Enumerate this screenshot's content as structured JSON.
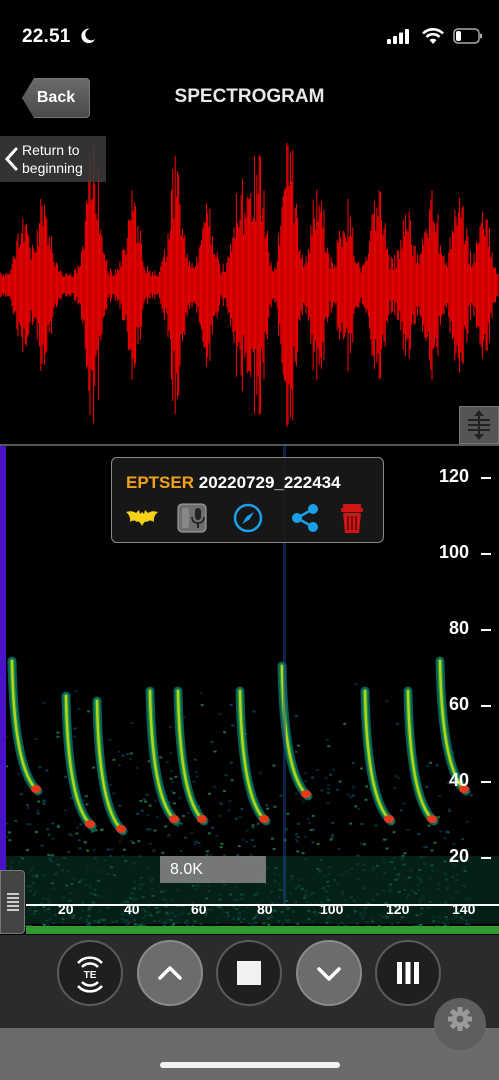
{
  "status_bar": {
    "time": "22.51"
  },
  "nav": {
    "back_label": "Back",
    "title": "SPECTROGRAM"
  },
  "waveform": {
    "return_label_line1": "Return to",
    "return_label_line2": "beginning"
  },
  "detection": {
    "species": "EPTSER",
    "recording_id": "20220729_222434"
  },
  "spectrogram": {
    "y_axis_labels": [
      "120",
      "100",
      "80",
      "60",
      "40",
      "20"
    ],
    "x_axis_labels": [
      "20",
      "40",
      "60",
      "80",
      "100",
      "120",
      "140"
    ],
    "frequency_readout": "8.0K"
  },
  "colors": {
    "waveform": "#ff0000",
    "species": "#f0a21a",
    "accent_blue": "#1aa0e8",
    "delete_red": "#d01616",
    "bat_yellow": "#f5d21a"
  }
}
